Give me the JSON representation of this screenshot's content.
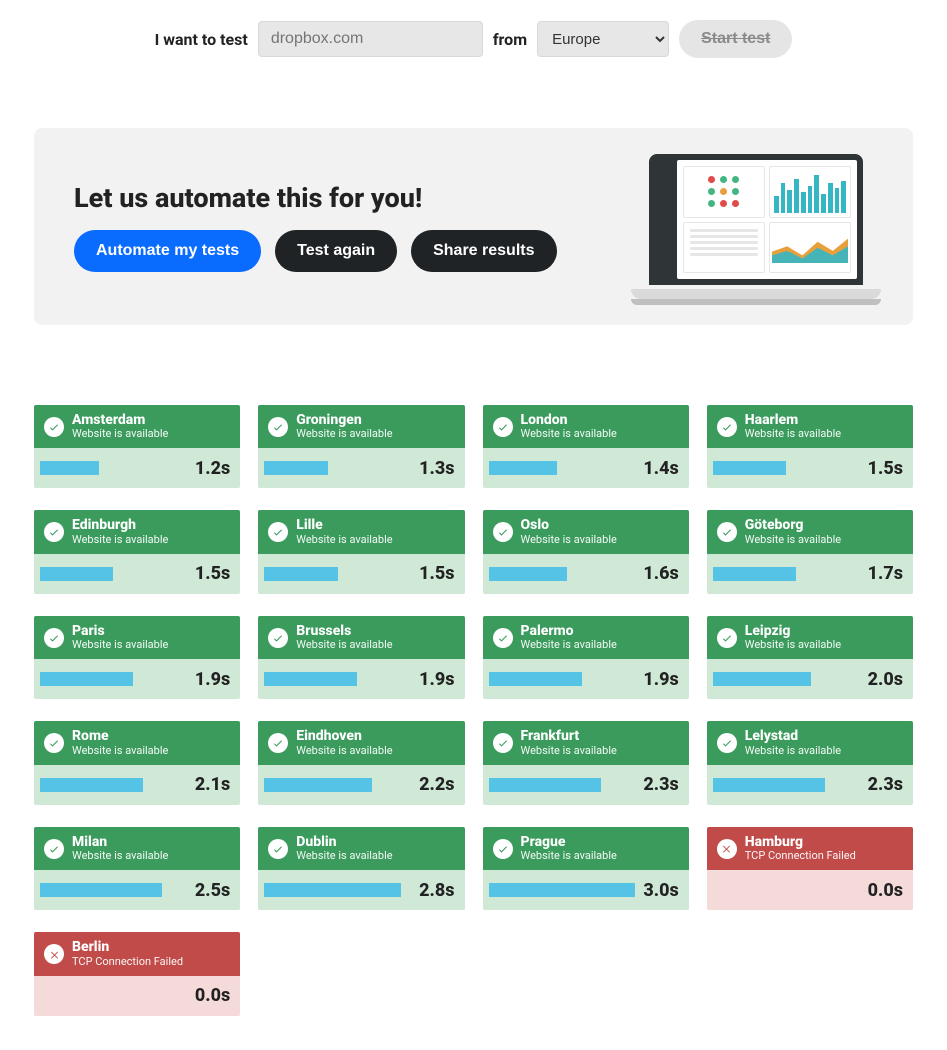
{
  "top": {
    "prefix": "I want to test",
    "placeholder": "dropbox.com",
    "from_label": "from",
    "region": "Europe",
    "start_label": "Start test"
  },
  "promo": {
    "title": "Let us automate this for you!",
    "automate": "Automate my tests",
    "again": "Test again",
    "share": "Share results"
  },
  "status_text": {
    "ok": "Website is available",
    "err": "TCP Connection Failed"
  },
  "max_time": 3.0,
  "results": [
    {
      "city": "Amsterdam",
      "ok": true,
      "time": 1.2
    },
    {
      "city": "Groningen",
      "ok": true,
      "time": 1.3
    },
    {
      "city": "London",
      "ok": true,
      "time": 1.4
    },
    {
      "city": "Haarlem",
      "ok": true,
      "time": 1.5
    },
    {
      "city": "Edinburgh",
      "ok": true,
      "time": 1.5
    },
    {
      "city": "Lille",
      "ok": true,
      "time": 1.5
    },
    {
      "city": "Oslo",
      "ok": true,
      "time": 1.6
    },
    {
      "city": "Göteborg",
      "ok": true,
      "time": 1.7
    },
    {
      "city": "Paris",
      "ok": true,
      "time": 1.9
    },
    {
      "city": "Brussels",
      "ok": true,
      "time": 1.9
    },
    {
      "city": "Palermo",
      "ok": true,
      "time": 1.9
    },
    {
      "city": "Leipzig",
      "ok": true,
      "time": 2.0
    },
    {
      "city": "Rome",
      "ok": true,
      "time": 2.1
    },
    {
      "city": "Eindhoven",
      "ok": true,
      "time": 2.2
    },
    {
      "city": "Frankfurt",
      "ok": true,
      "time": 2.3
    },
    {
      "city": "Lelystad",
      "ok": true,
      "time": 2.3
    },
    {
      "city": "Milan",
      "ok": true,
      "time": 2.5
    },
    {
      "city": "Dublin",
      "ok": true,
      "time": 2.8
    },
    {
      "city": "Prague",
      "ok": true,
      "time": 3.0
    },
    {
      "city": "Hamburg",
      "ok": false,
      "time": 0.0
    },
    {
      "city": "Berlin",
      "ok": false,
      "time": 0.0
    }
  ]
}
